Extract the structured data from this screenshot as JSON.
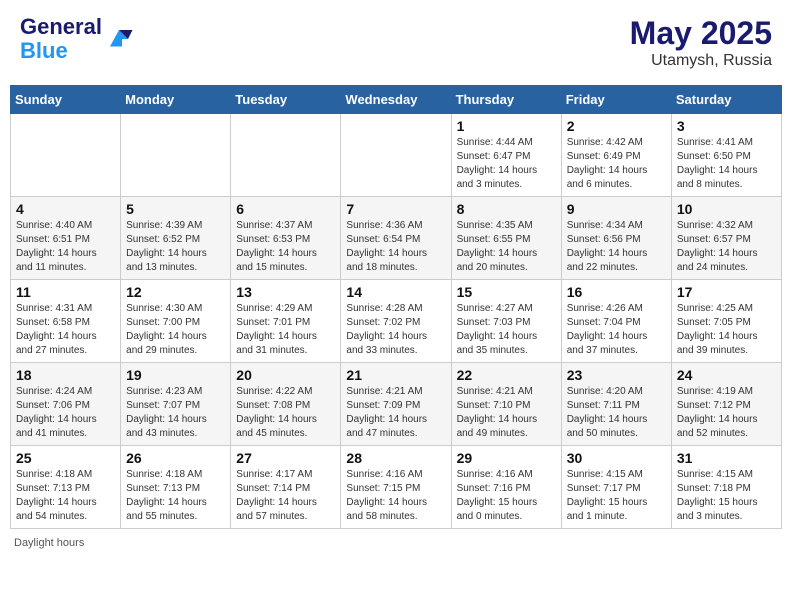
{
  "header": {
    "logo_line1": "General",
    "logo_line2": "Blue",
    "main_title": "May 2025",
    "subtitle": "Utamysh, Russia"
  },
  "days_of_week": [
    "Sunday",
    "Monday",
    "Tuesday",
    "Wednesday",
    "Thursday",
    "Friday",
    "Saturday"
  ],
  "weeks": [
    [
      {
        "day": "",
        "info": ""
      },
      {
        "day": "",
        "info": ""
      },
      {
        "day": "",
        "info": ""
      },
      {
        "day": "",
        "info": ""
      },
      {
        "day": "1",
        "info": "Sunrise: 4:44 AM\nSunset: 6:47 PM\nDaylight: 14 hours and 3 minutes."
      },
      {
        "day": "2",
        "info": "Sunrise: 4:42 AM\nSunset: 6:49 PM\nDaylight: 14 hours and 6 minutes."
      },
      {
        "day": "3",
        "info": "Sunrise: 4:41 AM\nSunset: 6:50 PM\nDaylight: 14 hours and 8 minutes."
      }
    ],
    [
      {
        "day": "4",
        "info": "Sunrise: 4:40 AM\nSunset: 6:51 PM\nDaylight: 14 hours and 11 minutes."
      },
      {
        "day": "5",
        "info": "Sunrise: 4:39 AM\nSunset: 6:52 PM\nDaylight: 14 hours and 13 minutes."
      },
      {
        "day": "6",
        "info": "Sunrise: 4:37 AM\nSunset: 6:53 PM\nDaylight: 14 hours and 15 minutes."
      },
      {
        "day": "7",
        "info": "Sunrise: 4:36 AM\nSunset: 6:54 PM\nDaylight: 14 hours and 18 minutes."
      },
      {
        "day": "8",
        "info": "Sunrise: 4:35 AM\nSunset: 6:55 PM\nDaylight: 14 hours and 20 minutes."
      },
      {
        "day": "9",
        "info": "Sunrise: 4:34 AM\nSunset: 6:56 PM\nDaylight: 14 hours and 22 minutes."
      },
      {
        "day": "10",
        "info": "Sunrise: 4:32 AM\nSunset: 6:57 PM\nDaylight: 14 hours and 24 minutes."
      }
    ],
    [
      {
        "day": "11",
        "info": "Sunrise: 4:31 AM\nSunset: 6:58 PM\nDaylight: 14 hours and 27 minutes."
      },
      {
        "day": "12",
        "info": "Sunrise: 4:30 AM\nSunset: 7:00 PM\nDaylight: 14 hours and 29 minutes."
      },
      {
        "day": "13",
        "info": "Sunrise: 4:29 AM\nSunset: 7:01 PM\nDaylight: 14 hours and 31 minutes."
      },
      {
        "day": "14",
        "info": "Sunrise: 4:28 AM\nSunset: 7:02 PM\nDaylight: 14 hours and 33 minutes."
      },
      {
        "day": "15",
        "info": "Sunrise: 4:27 AM\nSunset: 7:03 PM\nDaylight: 14 hours and 35 minutes."
      },
      {
        "day": "16",
        "info": "Sunrise: 4:26 AM\nSunset: 7:04 PM\nDaylight: 14 hours and 37 minutes."
      },
      {
        "day": "17",
        "info": "Sunrise: 4:25 AM\nSunset: 7:05 PM\nDaylight: 14 hours and 39 minutes."
      }
    ],
    [
      {
        "day": "18",
        "info": "Sunrise: 4:24 AM\nSunset: 7:06 PM\nDaylight: 14 hours and 41 minutes."
      },
      {
        "day": "19",
        "info": "Sunrise: 4:23 AM\nSunset: 7:07 PM\nDaylight: 14 hours and 43 minutes."
      },
      {
        "day": "20",
        "info": "Sunrise: 4:22 AM\nSunset: 7:08 PM\nDaylight: 14 hours and 45 minutes."
      },
      {
        "day": "21",
        "info": "Sunrise: 4:21 AM\nSunset: 7:09 PM\nDaylight: 14 hours and 47 minutes."
      },
      {
        "day": "22",
        "info": "Sunrise: 4:21 AM\nSunset: 7:10 PM\nDaylight: 14 hours and 49 minutes."
      },
      {
        "day": "23",
        "info": "Sunrise: 4:20 AM\nSunset: 7:11 PM\nDaylight: 14 hours and 50 minutes."
      },
      {
        "day": "24",
        "info": "Sunrise: 4:19 AM\nSunset: 7:12 PM\nDaylight: 14 hours and 52 minutes."
      }
    ],
    [
      {
        "day": "25",
        "info": "Sunrise: 4:18 AM\nSunset: 7:13 PM\nDaylight: 14 hours and 54 minutes."
      },
      {
        "day": "26",
        "info": "Sunrise: 4:18 AM\nSunset: 7:13 PM\nDaylight: 14 hours and 55 minutes."
      },
      {
        "day": "27",
        "info": "Sunrise: 4:17 AM\nSunset: 7:14 PM\nDaylight: 14 hours and 57 minutes."
      },
      {
        "day": "28",
        "info": "Sunrise: 4:16 AM\nSunset: 7:15 PM\nDaylight: 14 hours and 58 minutes."
      },
      {
        "day": "29",
        "info": "Sunrise: 4:16 AM\nSunset: 7:16 PM\nDaylight: 15 hours and 0 minutes."
      },
      {
        "day": "30",
        "info": "Sunrise: 4:15 AM\nSunset: 7:17 PM\nDaylight: 15 hours and 1 minute."
      },
      {
        "day": "31",
        "info": "Sunrise: 4:15 AM\nSunset: 7:18 PM\nDaylight: 15 hours and 3 minutes."
      }
    ]
  ],
  "footer": "Daylight hours"
}
